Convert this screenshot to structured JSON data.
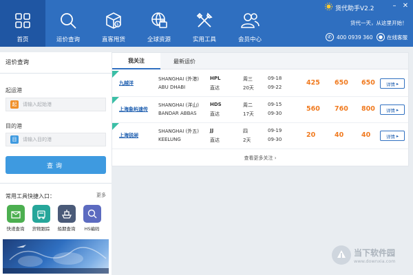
{
  "app": {
    "title": "货代助手V2.2",
    "greeting": "货代一天，从这里开始！",
    "phone": "400 0939 360",
    "online_service": "在线客服"
  },
  "nav": [
    {
      "label": "首页",
      "icon": "home-grid-icon",
      "active": true
    },
    {
      "label": "运价查询",
      "icon": "search-icon",
      "active": false
    },
    {
      "label": "直客甩货",
      "icon": "box-icon",
      "active": false
    },
    {
      "label": "全球资源",
      "icon": "globe-briefcase-icon",
      "active": false
    },
    {
      "label": "实用工具",
      "icon": "tools-icon",
      "active": false
    },
    {
      "label": "会员中心",
      "icon": "members-icon",
      "active": false
    }
  ],
  "search": {
    "title": "运价查询",
    "pol_label": "起运港",
    "pol_badge": "起",
    "pol_placeholder": "请输入起始港",
    "pod_label": "目的港",
    "pod_badge": "目",
    "pod_placeholder": "请输入目的港",
    "button": "查询"
  },
  "tools": {
    "title": "常用工具快捷入口：",
    "more": "更多",
    "items": [
      {
        "label": "快递查询",
        "icon": "express-icon",
        "color": "#4caf50"
      },
      {
        "label": "货物跟踪",
        "icon": "tracking-icon",
        "color": "#26a69a"
      },
      {
        "label": "船期查询",
        "icon": "ship-icon",
        "color": "#4a5a78"
      },
      {
        "label": "HS编码",
        "icon": "hs-code-icon",
        "color": "#5c6bc0"
      }
    ]
  },
  "tabs": [
    {
      "label": "我关注",
      "active": true
    },
    {
      "label": "最新运价",
      "active": false
    }
  ],
  "rates": [
    {
      "company": "九越洋",
      "pol": "SHANGHAI (外港)",
      "pod": "ABU DHABI",
      "carrier": "HPL",
      "route": "直达",
      "day": "周三",
      "transit": "20天",
      "date1": "09-18",
      "date2": "09-22",
      "p1": "425",
      "p2": "650",
      "p3": "650",
      "detail": "详情"
    },
    {
      "company": "上海象屿速传",
      "pol": "SHANGHAI (洋山)",
      "pod": "BANDAR ABBAS",
      "carrier": "HDS",
      "route": "直达",
      "day": "周二",
      "transit": "17天",
      "date1": "09-15",
      "date2": "09-30",
      "p1": "560",
      "p2": "760",
      "p3": "800",
      "detail": "详情"
    },
    {
      "company": "上海锐昶",
      "pol": "SHANGHAI (外五)",
      "pod": "KEELUNG",
      "carrier": "JJ",
      "route": "直达",
      "day": "四",
      "transit": "2天",
      "date1": "09-19",
      "date2": "09-30",
      "p1": "20",
      "p2": "40",
      "p3": "40",
      "detail": "详情"
    }
  ],
  "more_attention": "查看更多关注 ›",
  "colors": {
    "header": "#2f6fc0",
    "accent": "#3e9ae0",
    "price": "#f07a1f",
    "tag": "#3bbfa6"
  },
  "watermark": {
    "cn": "当下软件园",
    "url": "www.downxia.com"
  }
}
